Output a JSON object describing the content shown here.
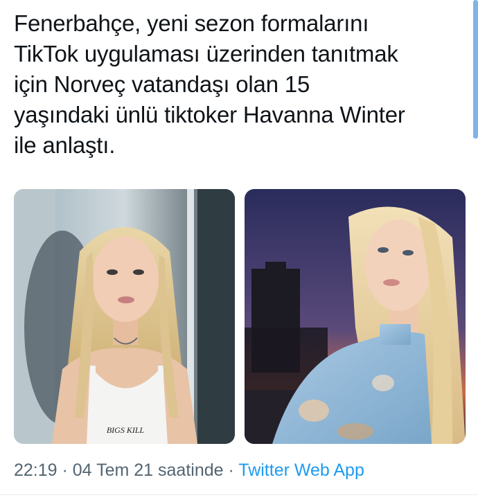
{
  "tweet": {
    "lines": [
      "Fenerbahçe, yeni sezon formalarını",
      "TikTok uygulaması üzerinden tanıtmak",
      "için Norveç vatandaşı olan 15",
      "yaşındaki ünlü tiktoker Havanna Winter",
      "ile anlaştı."
    ]
  },
  "media": {
    "photo1": {
      "shirt_print": "BIGS KILL"
    },
    "photo2": {}
  },
  "meta": {
    "time": "22:19",
    "sep1": " · ",
    "date": "04 Tem 21 saatinde",
    "sep2": " · ",
    "source": "Twitter Web App"
  },
  "colors": {
    "text": "#0f1419",
    "meta": "#536471",
    "link": "#1d9bf0"
  }
}
